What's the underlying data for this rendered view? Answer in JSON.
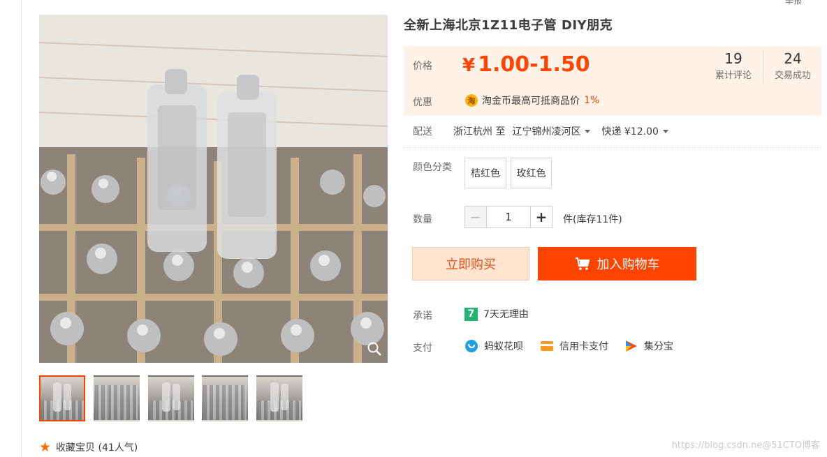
{
  "corner_text": "举报",
  "product": {
    "title": "全新上海北京1Z11电子管 DIY朋克"
  },
  "price": {
    "label": "价格",
    "currency": "¥",
    "range": "1.00-1.50",
    "review_count": "19",
    "review_label": "累计评论",
    "deal_count": "24",
    "deal_label": "交易成功"
  },
  "promo": {
    "label": "优惠",
    "coin_text": "淘",
    "text": "淘金币最高可抵商品价",
    "percent": "1%"
  },
  "delivery": {
    "label": "配送",
    "from": "浙江杭州 至",
    "to": "辽宁锦州凌河区",
    "method": "快递 ¥12.00"
  },
  "color": {
    "label": "颜色分类",
    "options": [
      "桔红色",
      "玫红色"
    ]
  },
  "quantity": {
    "label": "数量",
    "value": "1",
    "minus": "−",
    "plus": "+",
    "stock": "件(库存11件)"
  },
  "actions": {
    "buy_now": "立即购买",
    "add_to_cart": "加入购物车"
  },
  "promise": {
    "label": "承诺",
    "badge": "7",
    "text": "7天无理由"
  },
  "payment": {
    "label": "支付",
    "methods": [
      "蚂蚁花呗",
      "信用卡支付",
      "集分宝"
    ]
  },
  "favorite": {
    "text": "收藏宝贝 (41人气)"
  },
  "watermark": "https://blog.csdn.ne@51CTO博客",
  "colors": {
    "accent": "#ff4400",
    "price_bg": "#fff2e8",
    "buy_now_bg": "#ffe4d0"
  }
}
